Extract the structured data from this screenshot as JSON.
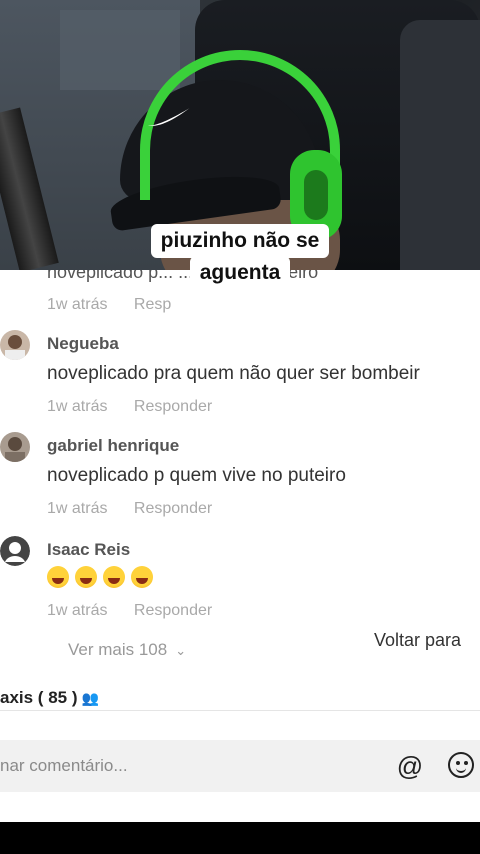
{
  "video": {
    "caption_line1": "piuzinho não se",
    "caption_line2": "aguenta"
  },
  "comments": {
    "partial_text": "noveplicado p... ...aino de porteiro",
    "partial_meta": {
      "time": "1w atrás",
      "reply": "Resp"
    },
    "items": [
      {
        "username": "Negueba",
        "text": "noveplicado pra quem não quer ser bombeir",
        "time": "1w atrás",
        "reply": "Responder"
      },
      {
        "username": "gabriel henrique",
        "text": "noveplicado p quem vive no puteiro",
        "time": "1w atrás",
        "reply": "Responder"
      },
      {
        "username": "Isaac Reis",
        "emojis": [
          "rofl-emoji",
          "rofl-emoji",
          "rofl-emoji",
          "rofl-emoji"
        ],
        "time": "1w atrás",
        "reply": "Responder"
      }
    ],
    "more_label": "Ver mais 108",
    "back_label": "Voltar para"
  },
  "bar": {
    "title": "axis ( 85 )"
  },
  "input": {
    "placeholder": "nar comentário..."
  }
}
